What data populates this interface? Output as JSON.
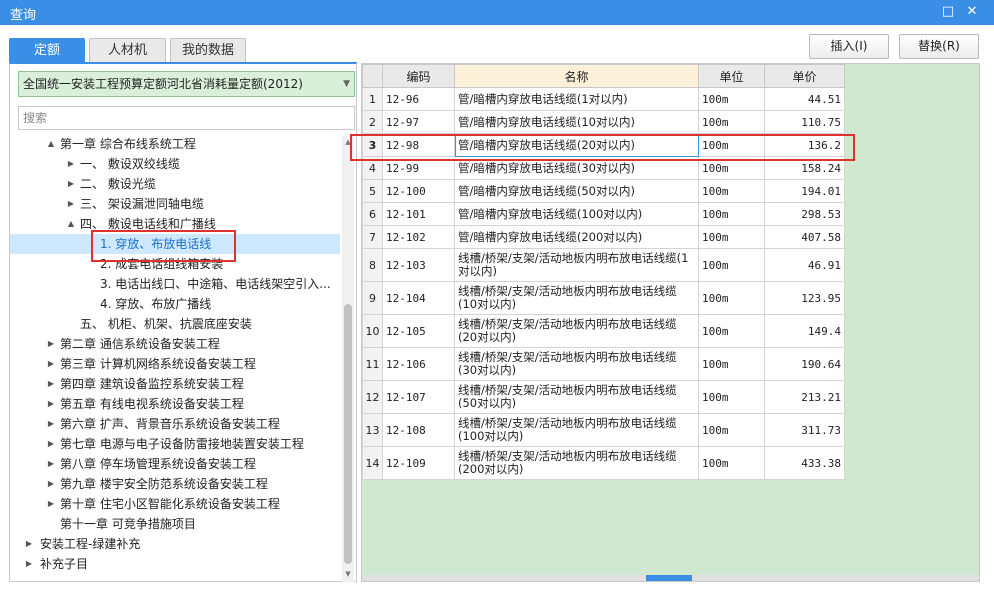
{
  "window": {
    "title": "查询",
    "restore_icon": "□",
    "close_icon": "✕"
  },
  "tabs": [
    {
      "label": "定额",
      "active": true
    },
    {
      "label": "人材机",
      "active": false
    },
    {
      "label": "我的数据",
      "active": false
    }
  ],
  "buttons": {
    "insert": "插入(I)",
    "replace": "替换(R)"
  },
  "left": {
    "dropdown": "全国统一安装工程预算定额河北省消耗量定额(2012)",
    "search_placeholder": "搜索",
    "tree": [
      {
        "toggle": "▲",
        "label": "第一章 综合布线系统工程"
      },
      {
        "toggle": "▶",
        "label": "一、 敷设双绞线缆"
      },
      {
        "toggle": "▶",
        "label": "二、 敷设光缆"
      },
      {
        "toggle": "▶",
        "label": "三、 架设漏泄同轴电缆"
      },
      {
        "toggle": "▲",
        "label": "四、 敷设电话线和广播线"
      },
      {
        "toggle": "",
        "label": "1. 穿放、布放电话线"
      },
      {
        "toggle": "",
        "label": "2. 成套电话组线箱安装"
      },
      {
        "toggle": "",
        "label": "3. 电话出线口、中途箱、电话线架空引入..."
      },
      {
        "toggle": "",
        "label": "4. 穿放、布放广播线"
      },
      {
        "toggle": "",
        "label": "五、 机柜、机架、抗震底座安装"
      },
      {
        "toggle": "▶",
        "label": "第二章 通信系统设备安装工程"
      },
      {
        "toggle": "▶",
        "label": "第三章 计算机网络系统设备安装工程"
      },
      {
        "toggle": "▶",
        "label": "第四章 建筑设备监控系统安装工程"
      },
      {
        "toggle": "▶",
        "label": "第五章 有线电视系统设备安装工程"
      },
      {
        "toggle": "▶",
        "label": "第六章 扩声、背景音乐系统设备安装工程"
      },
      {
        "toggle": "▶",
        "label": "第七章 电源与电子设备防雷接地装置安装工程"
      },
      {
        "toggle": "▶",
        "label": "第八章 停车场管理系统设备安装工程"
      },
      {
        "toggle": "▶",
        "label": "第九章 楼宇安全防范系统设备安装工程"
      },
      {
        "toggle": "▶",
        "label": "第十章 住宅小区智能化系统设备安装工程"
      },
      {
        "toggle": "",
        "label": "第十一章 可竞争措施项目"
      },
      {
        "toggle": "▶",
        "label": "安装工程-绿建补充"
      },
      {
        "toggle": "▶",
        "label": "补充子目"
      }
    ]
  },
  "table": {
    "headers": {
      "code": "编码",
      "name": "名称",
      "unit": "单位",
      "price": "单价"
    },
    "rows": [
      {
        "n": "1",
        "code": "12-96",
        "name": "管/暗槽内穿放电话线缆(1对以内)",
        "unit": "100m",
        "price": "44.51"
      },
      {
        "n": "2",
        "code": "12-97",
        "name": "管/暗槽内穿放电话线缆(10对以内)",
        "unit": "100m",
        "price": "110.75"
      },
      {
        "n": "3",
        "code": "12-98",
        "name": "管/暗槽内穿放电话线缆(20对以内)",
        "unit": "100m",
        "price": "136.2"
      },
      {
        "n": "4",
        "code": "12-99",
        "name": "管/暗槽内穿放电话线缆(30对以内)",
        "unit": "100m",
        "price": "158.24"
      },
      {
        "n": "5",
        "code": "12-100",
        "name": "管/暗槽内穿放电话线缆(50对以内)",
        "unit": "100m",
        "price": "194.01"
      },
      {
        "n": "6",
        "code": "12-101",
        "name": "管/暗槽内穿放电话线缆(100对以内)",
        "unit": "100m",
        "price": "298.53"
      },
      {
        "n": "7",
        "code": "12-102",
        "name": "管/暗槽内穿放电话线缆(200对以内)",
        "unit": "100m",
        "price": "407.58"
      },
      {
        "n": "8",
        "code": "12-103",
        "name": "线槽/桥架/支架/活动地板内明布放电话线缆(1对以内)",
        "unit": "100m",
        "price": "46.91"
      },
      {
        "n": "9",
        "code": "12-104",
        "name": "线槽/桥架/支架/活动地板内明布放电话线缆(10对以内)",
        "unit": "100m",
        "price": "123.95"
      },
      {
        "n": "10",
        "code": "12-105",
        "name": "线槽/桥架/支架/活动地板内明布放电话线缆(20对以内)",
        "unit": "100m",
        "price": "149.4"
      },
      {
        "n": "11",
        "code": "12-106",
        "name": "线槽/桥架/支架/活动地板内明布放电话线缆(30对以内)",
        "unit": "100m",
        "price": "190.64"
      },
      {
        "n": "12",
        "code": "12-107",
        "name": "线槽/桥架/支架/活动地板内明布放电话线缆(50对以内)",
        "unit": "100m",
        "price": "213.21"
      },
      {
        "n": "13",
        "code": "12-108",
        "name": "线槽/桥架/支架/活动地板内明布放电话线缆(100对以内)",
        "unit": "100m",
        "price": "311.73"
      },
      {
        "n": "14",
        "code": "12-109",
        "name": "线槽/桥架/支架/活动地板内明布放电话线缆(200对以内)",
        "unit": "100m",
        "price": "433.38"
      }
    ]
  },
  "colors": {
    "accent": "#3a8ee6",
    "highlight": "#e03030",
    "grid_bg": "#cfe8cf"
  }
}
